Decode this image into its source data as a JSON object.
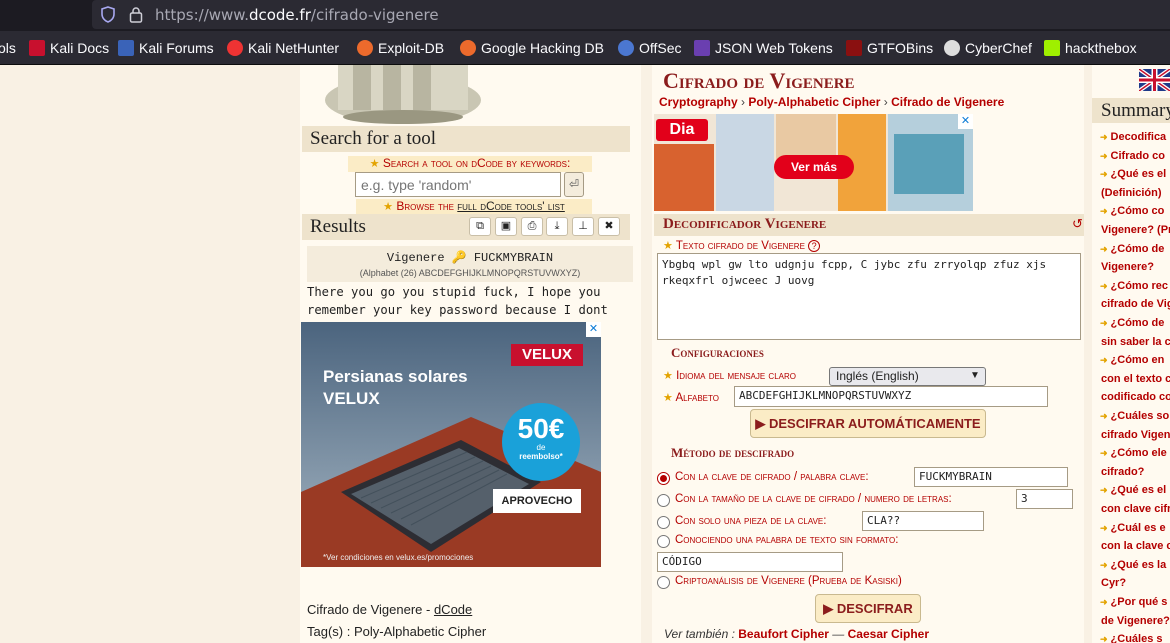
{
  "browser": {
    "url_prefix": "https://www.",
    "url_host": "dcode.fr",
    "url_path": "/cifrado-vigenere",
    "bookmarks": [
      "ols",
      "Kali Docs",
      "Kali Forums",
      "Kali NetHunter",
      "Exploit-DB",
      "Google Hacking DB",
      "OffSec",
      "JSON Web Tokens",
      "GTFOBins",
      "CyberChef",
      "hackthebox"
    ]
  },
  "search": {
    "title": "Search for a tool",
    "label": "Search a tool on dCode by keywords:",
    "placeholder": "e.g. type 'random'",
    "browse_prefix": "Browse the",
    "browse_link": "full dCode tools' list"
  },
  "results": {
    "title": "Results",
    "result_title": "Vigenere 🔑 FUCKMYBRAIN",
    "alphabet_line": "(Alphabet (26) ABCDEFGHIJKLMNOPQRSTUVWXYZ)",
    "line1": "There you go you stupid fuck, I hope you",
    "line2": "remember your key password because I dont"
  },
  "ad_velux": {
    "logo": "VELUX",
    "headline1": "Persianas solares",
    "headline2": "VELUX",
    "badge_big": "50€",
    "badge_small1": "de",
    "badge_small2": "reembolso*",
    "button": "APROVECHO",
    "footer": "*Ver condiciones en velux.es/promociones"
  },
  "left_footer": {
    "line1_prefix": "Cifrado de Vigenere - ",
    "line1_link": "dCode",
    "line2": "Tag(s) : Poly-Alphabetic Cipher"
  },
  "main": {
    "title": "Cifrado de Vigenere",
    "breadcrumb": [
      "Cryptography",
      "Poly-Alphabetic Cipher",
      "Cifrado de Vigenere"
    ],
    "ad_dia": {
      "logo": "Dia",
      "button": "Ver más"
    },
    "decoder_title": "Decodificador Vigenere",
    "cipher_label": "Texto cifrado de Vigenere",
    "cipher_text": "Ybgbq wpl gw lto udgnju fcpp, C jybc zfu zrryolqp zfuz xjs rkeqxfrl ojwceec J uovg",
    "config_title": "Configuraciones",
    "lang_label": "Idioma del mensaje claro",
    "lang_value": "Inglés (English)",
    "alphabet_label": "Alfabeto",
    "alphabet_value": "ABCDEFGHIJKLMNOPQRSTUVWXYZ",
    "auto_button": "▶ DESCIFRAR AUTOMÁTICAMENTE",
    "method_title": "Método de descifrado",
    "opt1_label": "Con la clave de cifrado / palabra clave:",
    "opt1_value": "FUCKMYBRAIN",
    "opt2_label": "Con la tamaño de la clave de cifrado / numero de letras:",
    "opt2_value": "3",
    "opt3_label": "Con solo una pieza de la clave:",
    "opt3_value": "CLA??",
    "opt4_label": "Conociendo una palabra de texto sin formato:",
    "opt4_value": "CÓDIGO",
    "opt5_label": "Criptoanálisis de Vigenere (Prueba de Kasiski)",
    "decipher_button": "▶ DESCIFRAR",
    "see_also_prefix": "Ver también :",
    "see_also_1": "Beaufort Cipher",
    "see_also_sep": "—",
    "see_also_2": "Caesar Cipher"
  },
  "summary": {
    "title": "Summary",
    "items": [
      "Decodifica",
      "Cifrado co",
      "¿Qué es el",
      "(Definición)",
      "¿Cómo co",
      "Vigenere? (Pr",
      "¿Cómo de",
      "Vigenere?",
      "¿Cómo rec",
      "cifrado de Vig",
      "¿Cómo de",
      "sin saber la c",
      "¿Cómo en",
      "con el texto c",
      "codificado co",
      "¿Cuáles so",
      "cifrado Vigen",
      "¿Cómo ele",
      "cifrado?",
      "¿Qué es el",
      "con clave cifr",
      "¿Cuál es e",
      "con la clave c",
      "¿Qué es la",
      "Cyr?",
      "¿Por qué s",
      "de Vigenere?",
      "¿Cuáles s"
    ]
  }
}
